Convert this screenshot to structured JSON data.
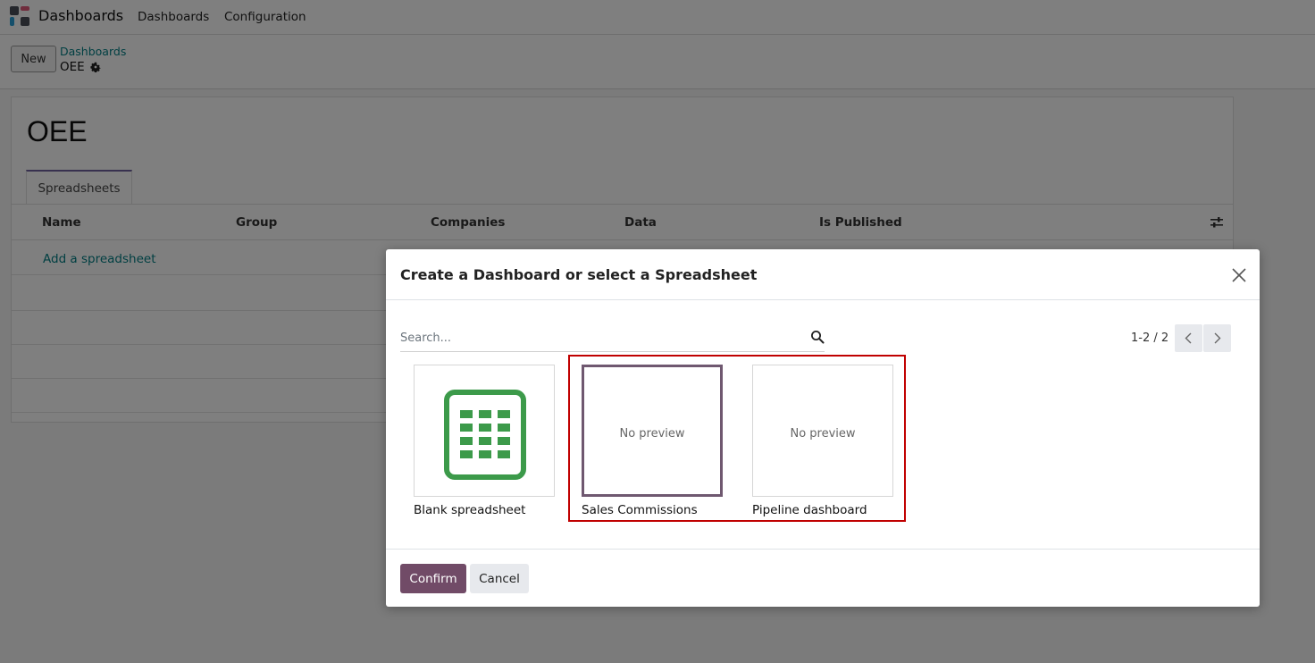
{
  "navbar": {
    "app_name": "Dashboards",
    "menu_items": [
      "Dashboards",
      "Configuration"
    ],
    "app_icon": "dashboards-app-icon"
  },
  "control_panel": {
    "new_label": "New",
    "breadcrumb_parent": "Dashboards",
    "breadcrumb_current": "OEE",
    "settings_icon": "gear-icon"
  },
  "form": {
    "title": "OEE",
    "tab_label": "Spreadsheets",
    "columns": [
      "Name",
      "Group",
      "Companies",
      "Data",
      "Is Published"
    ],
    "add_line_label": "Add a spreadsheet",
    "optional_columns_icon": "sliders-icon"
  },
  "dialog": {
    "title": "Create a Dashboard or select a Spreadsheet",
    "close_icon": "close-icon",
    "search_placeholder": "Search...",
    "search_value": "",
    "pager_value": "1-2 / 2",
    "cards": [
      {
        "label": "Blank spreadsheet",
        "preview": "spreadsheet-icon",
        "selected": false
      },
      {
        "label": "Sales Commissions",
        "preview": "No preview",
        "selected": true
      },
      {
        "label": "Pipeline dashboard",
        "preview": "No preview",
        "selected": false
      }
    ],
    "confirm_label": "Confirm",
    "cancel_label": "Cancel"
  },
  "colors": {
    "primary": "#714b67",
    "link": "#017e84",
    "selected_border": "#6f5870",
    "highlight": "#c00000",
    "spreadsheet_green": "#3c9a4a"
  }
}
